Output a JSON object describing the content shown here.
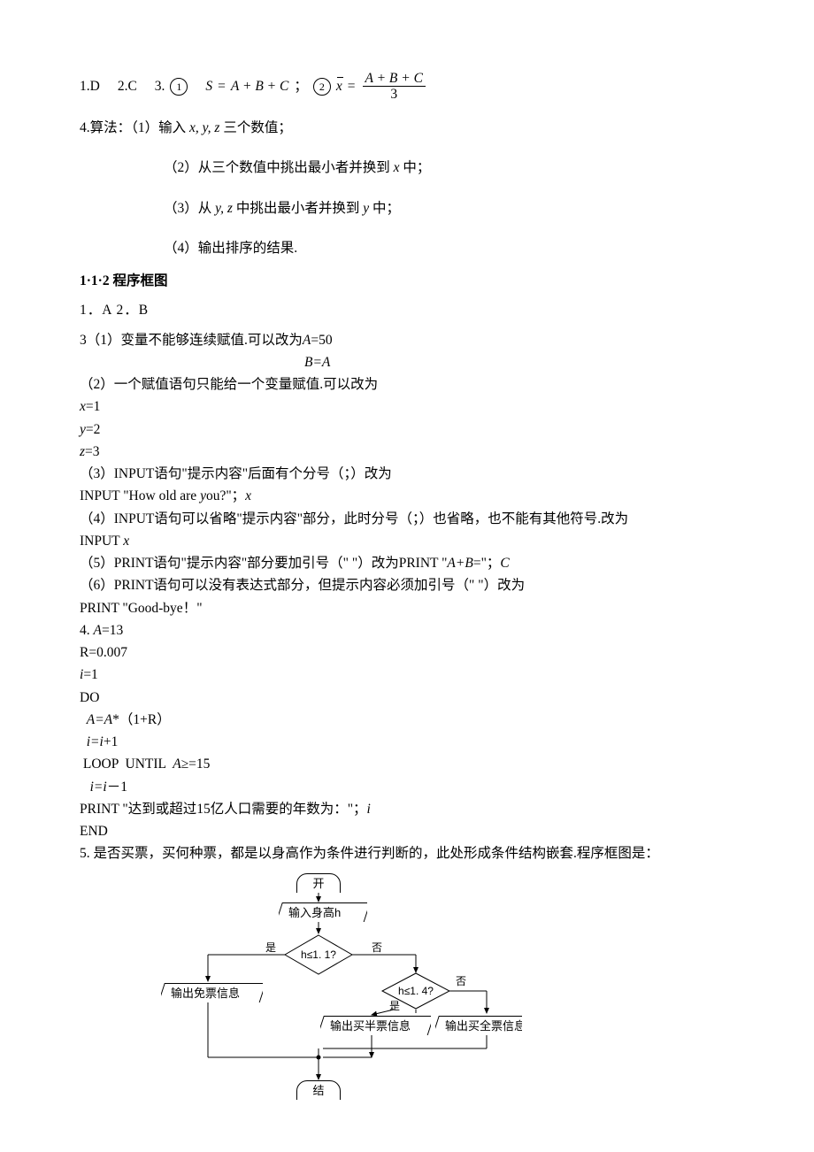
{
  "answers": {
    "q1": "1.D",
    "q2": "2.C",
    "q3_prefix": "3.",
    "circle1": "1",
    "formula1_lhs": "S",
    "formula1_eq": "=",
    "formula1_rhs": "A + B + C",
    "sep": "；",
    "circle2": "2",
    "formula2_lhs": "x",
    "formula2_eq": "=",
    "formula2_num": "A + B + C",
    "formula2_den": "3"
  },
  "p4": {
    "lead": "4.算法：（1）输入 ",
    "vars1": "x, y, z",
    "tail1": " 三个数值；",
    "s2a": "（2）从三个数值中挑出最小者并换到 ",
    "s2v": "x",
    "s2b": " 中；",
    "s3a": "（3）从 ",
    "s3v": "y, z",
    "s3b": " 中挑出最小者并换到 ",
    "s3v2": "y",
    "s3c": " 中；",
    "s4": "（4）输出排序的结果."
  },
  "sec112": {
    "title": "1·1·2 程序框图",
    "ans": "1．A  2．B",
    "l3_1": "3（1）变量不能够连续赋值.可以改为",
    "l3_1r_i": "A",
    "l3_1r_t": "=50",
    "l3_ba_i": "B=A",
    "l3_2": "（2）一个赋值语句只能给一个变量赋值.可以改为",
    "x1_i": "x",
    "x1_t": "=1",
    "y2_i": "y",
    "y2_t": "=2",
    "z3_i": "z",
    "z3_t": "=3",
    "l3_3": "（3）INPUT语句\"提示内容\"后面有个分号（；）改为",
    "inp1a": "INPUT  \"How old are ",
    "inp1y": "y",
    "inp1b": "ou?\"；",
    "inp1x": "x",
    "l3_4": "（4）INPUT语句可以省略\"提示内容\"部分，此时分号（；）也省略，也不能有其他符号.改为",
    "inp2a": "INPUT  ",
    "inp2x": "x",
    "l3_5a": "（5）PRINT语句\"提示内容\"部分要加引号（\" \"）改为PRINT  \"",
    "l3_5i": "A+B",
    "l3_5b": "=\"；",
    "l3_5c": "C",
    "l3_6": "（6）PRINT语句可以没有表达式部分，但提示内容必须加引号（\" \"）改为",
    "pbye": "PRINT  \"Good-bye！\"",
    "l4a": "4.  ",
    "l4i": "A",
    "l4b": "=13",
    "rline": "R=0.007",
    "i1_i": "i",
    "i1_t": "=1",
    "do": "DO",
    "aar_a": "  ",
    "aar_i1": "A=A",
    "aar_t": "*（1+R）",
    "ii1_a": "  ",
    "ii1_i": "i=i",
    "ii1_t": "+1",
    "loop_a": " LOOP  UNTIL  ",
    "loop_i": "A",
    "loop_t": "≥=15",
    "ii2_a": "   ",
    "ii2_i": "i=i",
    "ii2_t": "－1",
    "pr2a": "PRINT  \"达到或超过15亿人口需要的年数为：\"；",
    "pr2i": "i",
    "end": "END",
    "l5": "5. 是否买票，买何种票，都是以身高作为条件进行判断的，此处形成条件结构嵌套.程序框图是："
  },
  "flow": {
    "start": "开始",
    "input": "输入身高h",
    "cond1": "h≤1. 1?",
    "cond2": "h≤1. 4?",
    "yes": "是",
    "no": "否",
    "out_free": "输出免票信息",
    "out_half": "输出买半票信息",
    "out_full": "输出买全票信息",
    "end": "结束"
  }
}
